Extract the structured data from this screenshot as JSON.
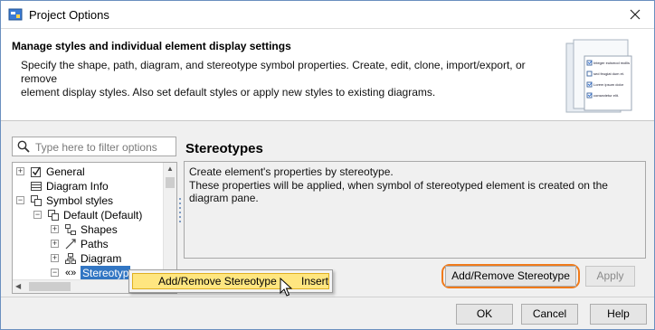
{
  "window": {
    "title": "Project Options"
  },
  "header": {
    "title": "Manage styles and individual element display settings",
    "desc_line1": "Specify the shape, path, diagram, and stereotype symbol properties. Create, edit, clone, import/export, or remove",
    "desc_line2": "element display styles. Also set default styles or apply new styles to existing diagrams.",
    "illustration_lines": [
      "Integer euismod mollis",
      "sed feugiat dum et.",
      "Lorem ipsum dolor",
      "consectetur elit."
    ]
  },
  "filter": {
    "placeholder": "Type here to filter options"
  },
  "tree": {
    "items": [
      {
        "label": "General",
        "icon": "checkbox-icon",
        "expander": "+"
      },
      {
        "label": "Diagram Info",
        "icon": "table-icon",
        "expander": ""
      },
      {
        "label": "Symbol styles",
        "icon": "styles-icon",
        "expander": "-"
      },
      {
        "label": "Default (Default)",
        "icon": "styles-icon",
        "expander": "-"
      },
      {
        "label": "Shapes",
        "icon": "shapes-icon",
        "expander": "+"
      },
      {
        "label": "Paths",
        "icon": "path-icon",
        "expander": "+"
      },
      {
        "label": "Diagram",
        "icon": "diagram-icon",
        "expander": "+"
      },
      {
        "label": "Stereotyp",
        "icon": "stereotype-icon",
        "expander": "-",
        "prefix": "«»"
      }
    ]
  },
  "main": {
    "title": "Stereotypes",
    "desc_line1": "Create element's properties by stereotype.",
    "desc_line2": "These properties will be applied, when symbol of stereotyped element is created on the diagram pane."
  },
  "buttons": {
    "add_remove": "Add/Remove Stereotype",
    "apply": "Apply",
    "ok": "OK",
    "cancel": "Cancel",
    "help": "Help"
  },
  "context_menu": {
    "item_label": "Add/Remove Stereotype",
    "item_shortcut": "Insert"
  },
  "colors": {
    "selection": "#3276c3",
    "menu_highlight": "#ffe680",
    "emphasis_ring": "#f07a1a"
  }
}
